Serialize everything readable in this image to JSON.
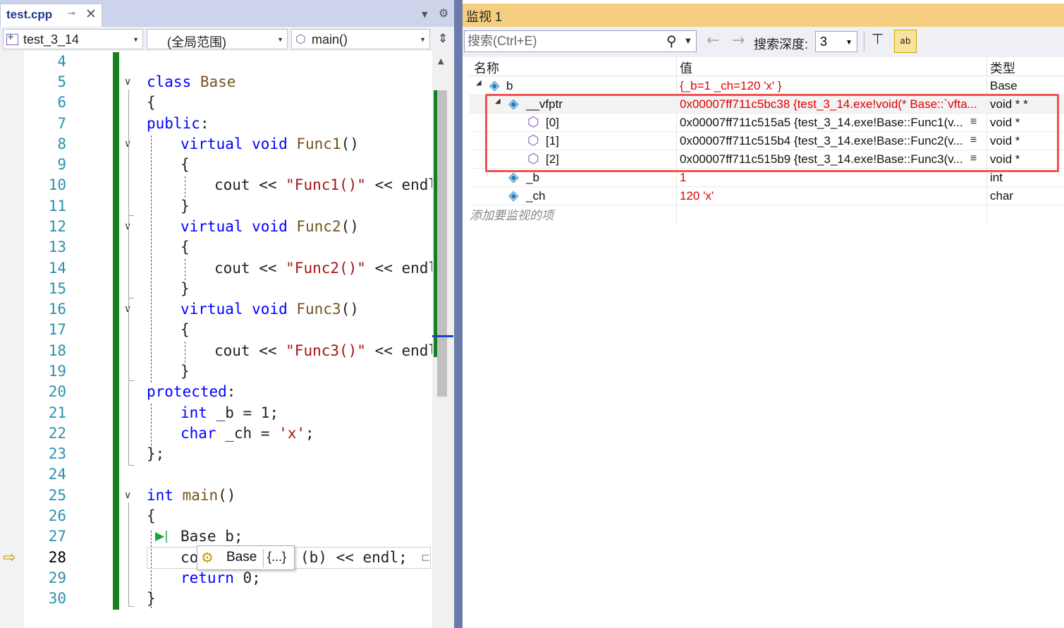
{
  "editor": {
    "tab": {
      "filename": "test.cpp",
      "pin_icon": "pin-icon",
      "close_icon": "close-icon"
    },
    "nav": {
      "project": "test_3_14",
      "scope": "(全局范围)",
      "member": "main()"
    },
    "line_numbers": [
      "4",
      "5",
      "6",
      "7",
      "8",
      "9",
      "10",
      "11",
      "12",
      "13",
      "14",
      "15",
      "16",
      "17",
      "18",
      "19",
      "20",
      "21",
      "22",
      "23",
      "24",
      "25",
      "26",
      "27",
      "28",
      "29",
      "30"
    ],
    "current_line": "28",
    "code": {
      "l5": {
        "kw": "class",
        "name": " Base"
      },
      "l6": "{",
      "l7": {
        "kw": "public",
        "rest": ":"
      },
      "l8": {
        "kw": "virtual",
        "kw2": " void",
        "fn": " Func1",
        "rest": "()"
      },
      "l9": "{",
      "l10": {
        "pre": "cout << ",
        "str": "\"Func1()\"",
        "post": " << endl;"
      },
      "l11": "}",
      "l12": {
        "kw": "virtual",
        "kw2": " void",
        "fn": " Func2",
        "rest": "()"
      },
      "l13": "{",
      "l14": {
        "pre": "cout << ",
        "str": "\"Func2()\"",
        "post": " << endl;"
      },
      "l15": "}",
      "l16": {
        "kw": "virtual",
        "kw2": " void",
        "fn": " Func3",
        "rest": "()"
      },
      "l17": "{",
      "l18": {
        "pre": "cout << ",
        "str": "\"Func3()\"",
        "post": " << endl;"
      },
      "l19": "}",
      "l20": {
        "kw": "protected",
        "rest": ":"
      },
      "l21": {
        "kw": "int",
        "rest": " _b = 1;"
      },
      "l22": {
        "kw": "char",
        "rest": " _ch = ",
        "chr": "'x'",
        "end": ";"
      },
      "l23": "};",
      "l25": {
        "kw": "int",
        "fn": " main",
        "rest": "()"
      },
      "l26": "{",
      "l27": "Base b;",
      "l28": {
        "pre": "co",
        "post": "(b) << endl;"
      },
      "l29": {
        "kw": "return",
        "rest": " 0;"
      },
      "l30": "}"
    },
    "datatip": {
      "type": "Base",
      "value": "{...}"
    }
  },
  "watch": {
    "title": "监视 1",
    "search_placeholder": "搜索(Ctrl+E)",
    "depth_label": "搜索深度:",
    "depth_value": "3",
    "columns": {
      "name": "名称",
      "value": "值",
      "type": "类型"
    },
    "rows": [
      {
        "name": "b",
        "value": "{_b=1 _ch=120 'x' }",
        "type": "Base",
        "value_color": "#e00000"
      },
      {
        "name": "__vfptr",
        "value": "0x00007ff711c5bc38 {test_3_14.exe!void(* Base::`vfta...",
        "type": "void * *",
        "value_color": "#e00000"
      },
      {
        "name": "[0]",
        "value": "0x00007ff711c515a5 {test_3_14.exe!Base::Func1(v...",
        "type": "void *"
      },
      {
        "name": "[1]",
        "value": "0x00007ff711c515b4 {test_3_14.exe!Base::Func2(v...",
        "type": "void *"
      },
      {
        "name": "[2]",
        "value": "0x00007ff711c515b9 {test_3_14.exe!Base::Func3(v...",
        "type": "void *"
      },
      {
        "name": "_b",
        "value": "1",
        "type": "int",
        "value_color": "#e00000"
      },
      {
        "name": "_ch",
        "value": "120 'x'",
        "type": "char",
        "value_color": "#e00000"
      }
    ],
    "add_item_placeholder": "添加要监视的项",
    "highlight_color": "#f05252"
  }
}
